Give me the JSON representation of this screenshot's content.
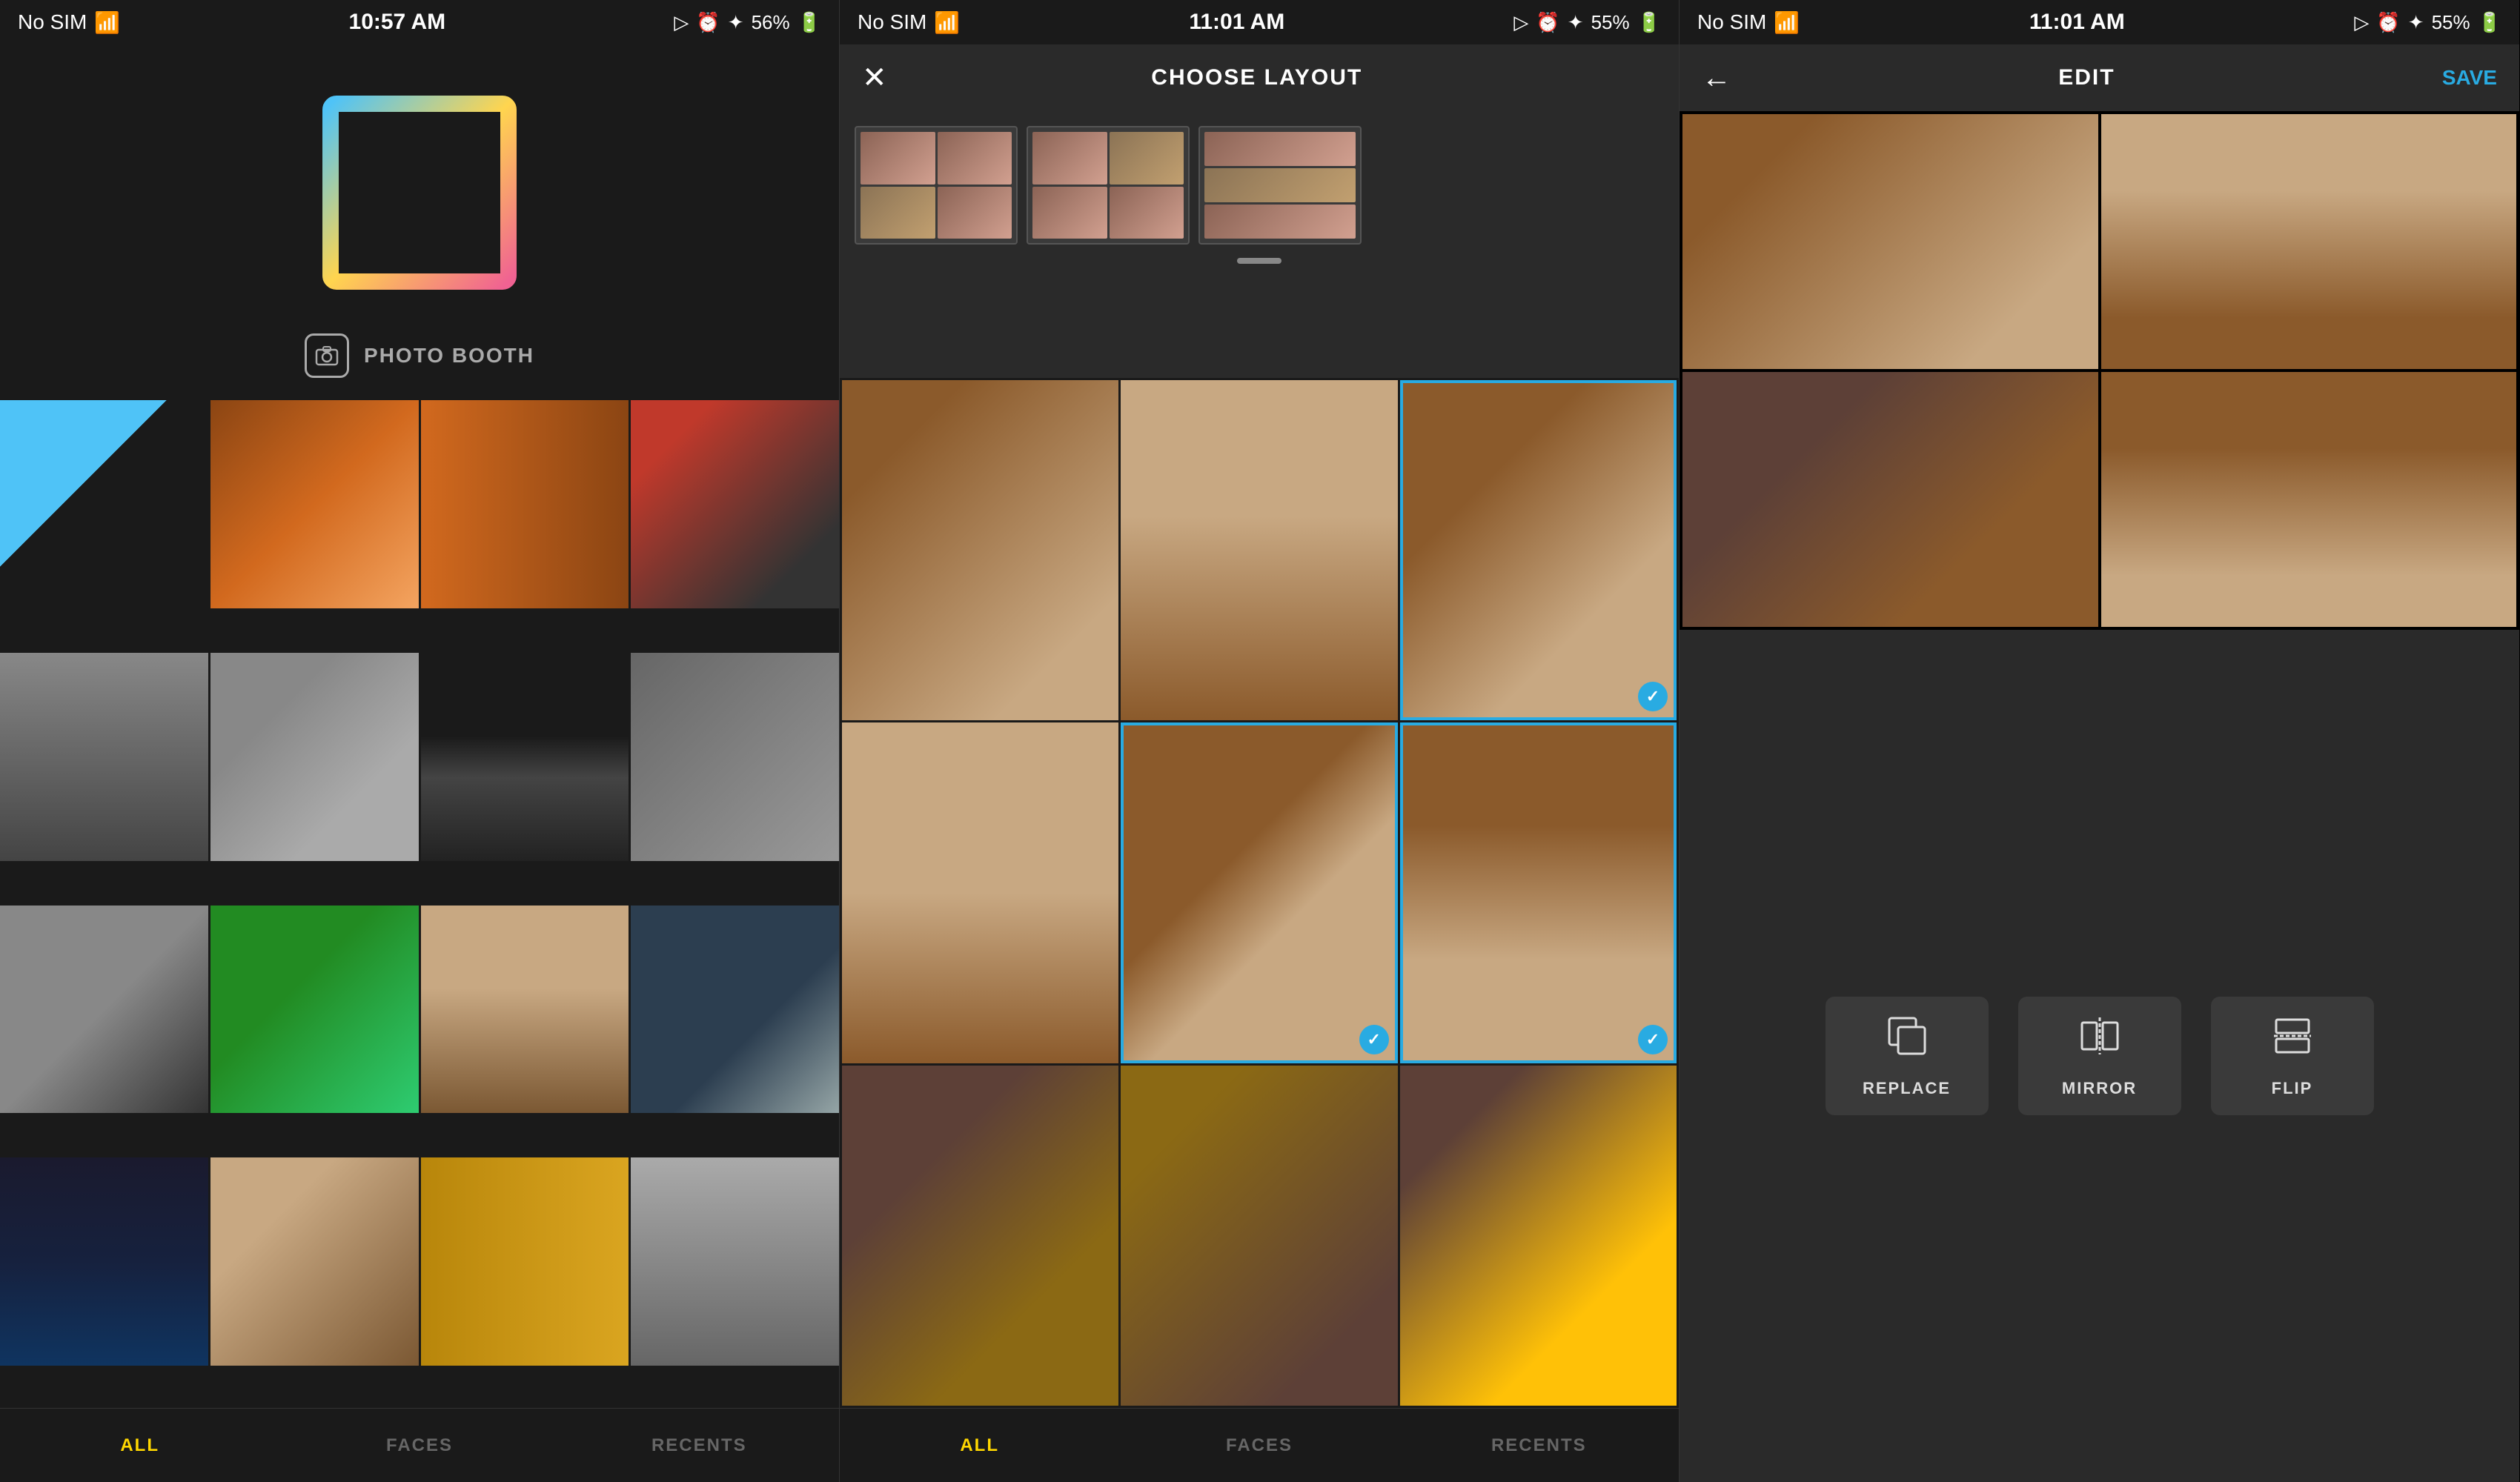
{
  "phone1": {
    "statusBar": {
      "left": "No SIM",
      "center": "10:57 AM",
      "right": "56%"
    },
    "photoBooth": "PHOTO BOOTH",
    "tabs": [
      {
        "id": "all",
        "label": "ALL",
        "active": true
      },
      {
        "id": "faces",
        "label": "FACES",
        "active": false
      },
      {
        "id": "recents",
        "label": "RECENTS",
        "active": false
      }
    ]
  },
  "phone2": {
    "statusBar": {
      "left": "No SIM",
      "center": "11:01 AM",
      "right": "55%"
    },
    "navClose": "✕",
    "navTitle": "CHOOSE LAYOUT",
    "tabs": [
      {
        "id": "all",
        "label": "ALL",
        "active": true
      },
      {
        "id": "faces",
        "label": "FACES",
        "active": false
      },
      {
        "id": "recents",
        "label": "RECENTS",
        "active": false
      }
    ]
  },
  "phone3": {
    "statusBar": {
      "left": "No SIM",
      "center": "11:01 AM",
      "right": "55%"
    },
    "navBack": "←",
    "navTitle": "EDIT",
    "navSave": "SAVE",
    "tools": [
      {
        "id": "replace",
        "label": "REPLACE",
        "icon": "⧉"
      },
      {
        "id": "mirror",
        "label": "MIRROR",
        "icon": "⫿"
      },
      {
        "id": "flip",
        "label": "FLIP",
        "icon": "⊟"
      }
    ]
  }
}
